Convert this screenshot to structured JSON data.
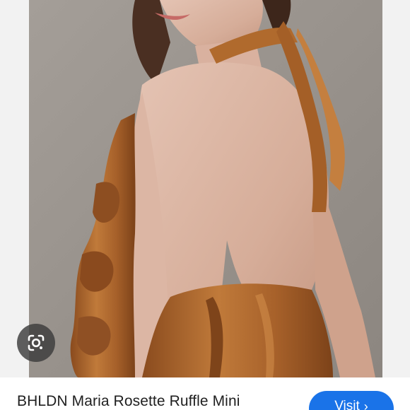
{
  "result": {
    "title": "BHLDN Maria Rosette Ruffle Mini",
    "visit_label": "Visit",
    "visit_chevron": "›"
  },
  "icons": {
    "lens": "google-lens-icon",
    "chevron": "chevron-right-icon"
  },
  "colors": {
    "accent": "#1a73e8",
    "dress": "#b26a2c",
    "backdrop": "#9a948f"
  }
}
